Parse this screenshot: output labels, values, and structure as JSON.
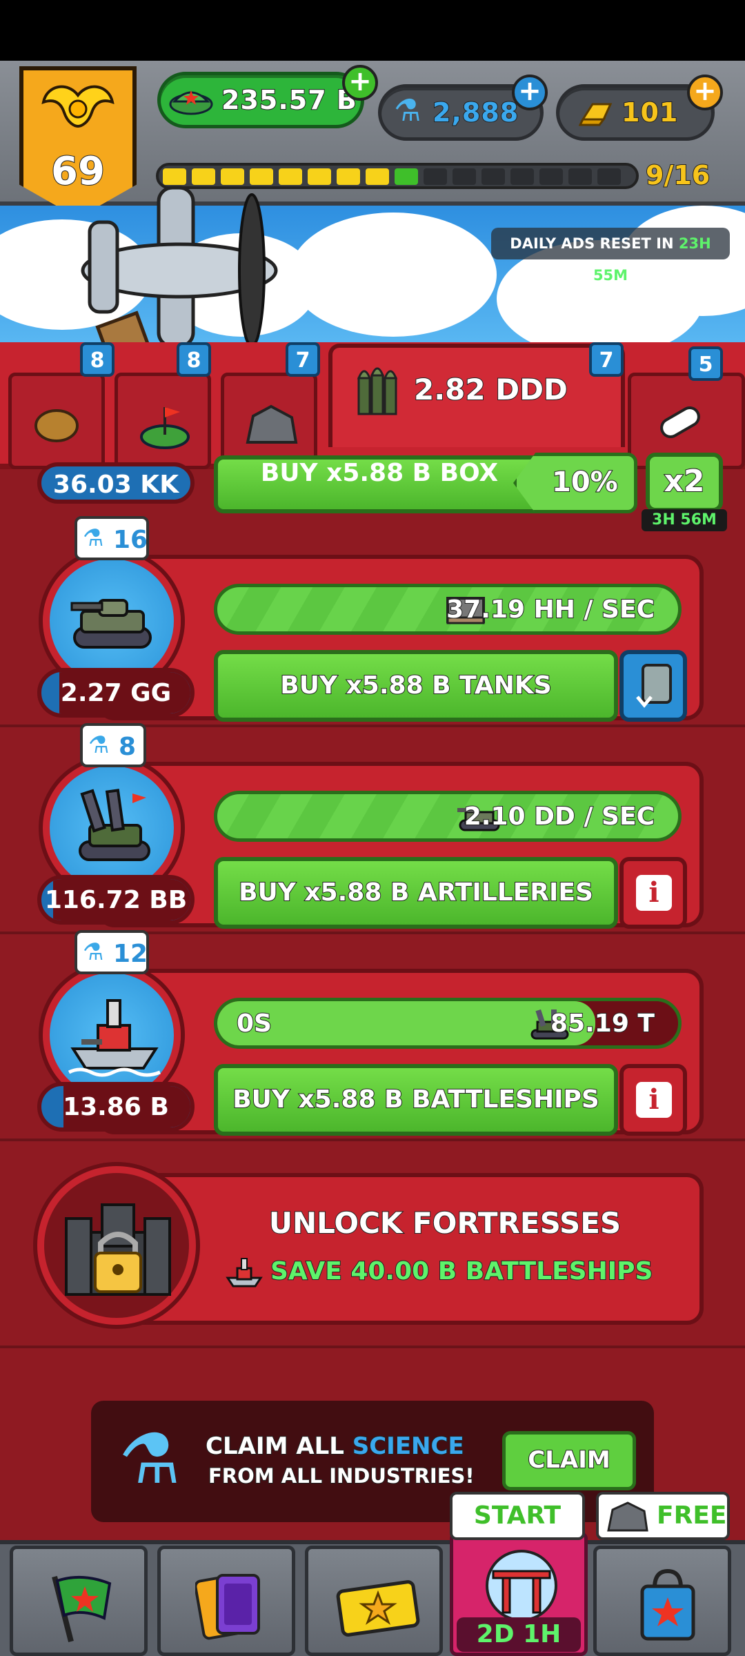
{
  "hud": {
    "level": "69",
    "cash": "235.57 B",
    "science": "2,888",
    "gold": "101",
    "xp_progress": "9/16",
    "xp_fraction": 0.5625
  },
  "sky": {
    "ads_reset_label": "DAILY ADS RESET IN ",
    "ads_reset_time": "23H 55M"
  },
  "resource_tabs": [
    {
      "name": "potato",
      "count": "8"
    },
    {
      "name": "field",
      "count": "8"
    },
    {
      "name": "ore",
      "count": "7"
    }
  ],
  "ammo_tab": {
    "value": "2.82 DDD",
    "badge": "7"
  },
  "extra_tab": {
    "badge": "5"
  },
  "boost": {
    "percent": "10%",
    "x2_label": "x2",
    "x2_timer": "3H 56M"
  },
  "partial_row": {
    "count": "36.03 KK",
    "buy_label": "BUY x5.88 B BOX"
  },
  "units": [
    {
      "name": "tanks",
      "science": "16",
      "count": "2.27 GG",
      "count_fill": 0.12,
      "rate": "37.19 HH / SEC",
      "rate_fill": 1.0,
      "buy_label": "BUY x5.88 B TANKS"
    },
    {
      "name": "artilleries",
      "science": "8",
      "count": "116.72 BB",
      "count_fill": 0.08,
      "rate": "2.10 DD / SEC",
      "rate_fill": 1.0,
      "buy_label": "BUY x5.88 B ARTILLERIES"
    },
    {
      "name": "battleships",
      "science": "12",
      "count": "13.86 B",
      "count_fill": 0.15,
      "rate_timer": "0S",
      "rate": "85.19 T",
      "rate_fill": 0.82,
      "buy_label": "BUY x5.88 B BATTLESHIPS"
    }
  ],
  "unlock": {
    "title": "UNLOCK FORTRESSES",
    "requirement": "SAVE 40.00 B BATTLESHIPS"
  },
  "claim": {
    "line1_prefix": "CLAIM ALL ",
    "line1_highlight": "SCIENCE",
    "line2": "FROM ALL INDUSTRIES!",
    "button": "CLAIM"
  },
  "nav": {
    "start_label": "START",
    "free_label": "FREE",
    "event_timer": "2D 1H"
  },
  "colors": {
    "accent_green": "#5ef36b",
    "science_blue": "#2a8fd6",
    "panel_red": "#c6232e"
  }
}
